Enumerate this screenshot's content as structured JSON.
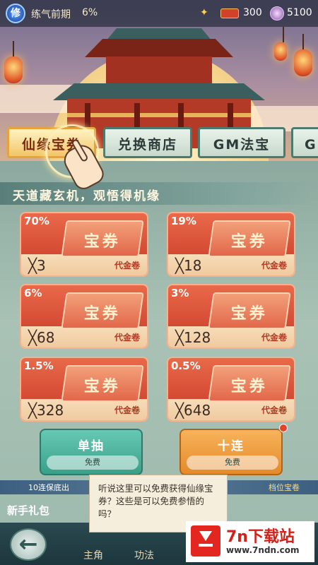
{
  "header": {
    "realm_badge": "修",
    "realm_name": "练气前期",
    "realm_progress": "6%",
    "coupon_count": "300",
    "gem_count": "5100"
  },
  "tabs": [
    {
      "label": "仙缘宝券",
      "active": true
    },
    {
      "label": "兑换商店",
      "active": false
    },
    {
      "label": "GM法宝",
      "active": false
    },
    {
      "label": "G",
      "active": false
    }
  ],
  "section_title": "天道藏玄机，观悟得机缘",
  "cards": [
    {
      "rate": "70%",
      "ticket_label": "宝券",
      "qty": "╳3",
      "unit": "代金卷"
    },
    {
      "rate": "19%",
      "ticket_label": "宝券",
      "qty": "╳18",
      "unit": "代金卷"
    },
    {
      "rate": "6%",
      "ticket_label": "宝券",
      "qty": "╳68",
      "unit": "代金卷"
    },
    {
      "rate": "3%",
      "ticket_label": "宝券",
      "qty": "╳128",
      "unit": "代金卷"
    },
    {
      "rate": "1.5%",
      "ticket_label": "宝券",
      "qty": "╳328",
      "unit": "代金卷"
    },
    {
      "rate": "0.5%",
      "ticket_label": "宝券",
      "qty": "╳648",
      "unit": "代金卷"
    }
  ],
  "draw": {
    "single_label": "单抽",
    "single_cost": "免费",
    "ten_label": "十连",
    "ten_cost": "免费"
  },
  "guarantee": {
    "left": "10连保底出",
    "right": "档位宝卷"
  },
  "newbie_label": "新手礼包",
  "dialog_text": "听说这里可以免费获得仙缘宝券？这些是可以免费参悟的吗？",
  "nav": {
    "back": "←",
    "hero": "主角",
    "skill": "功法"
  },
  "watermark": {
    "title": "7n下载站",
    "url": "www.7ndn.com"
  },
  "colors": {
    "accent_gold": "#f2c668",
    "card_red": "#c83a26",
    "single_teal": "#3a9f88",
    "ten_orange": "#e58a2a"
  }
}
